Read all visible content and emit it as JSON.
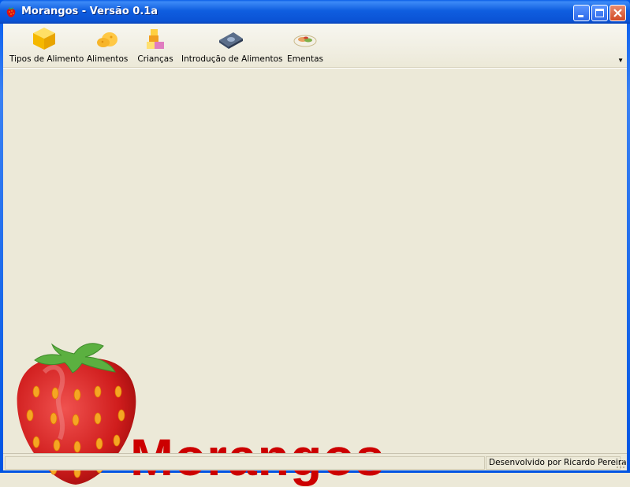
{
  "window": {
    "title": "Morangos - Versão 0.1a",
    "controls": [
      "minimize",
      "maximize",
      "close"
    ]
  },
  "toolbar": {
    "items": [
      {
        "label": "Tipos de Alimento",
        "icon": "yellow-cube-icon"
      },
      {
        "label": "Alimentos",
        "icon": "cheese-icon"
      },
      {
        "label": "Crianças",
        "icon": "toy-blocks-icon"
      },
      {
        "label": "Introdução de Alimentos",
        "icon": "disk-drive-icon"
      },
      {
        "label": "Ementas",
        "icon": "food-plate-icon"
      }
    ]
  },
  "logo": {
    "text": "Morangos",
    "color": "#cc0000"
  },
  "status": {
    "right": "Desenvolvido por Ricardo Pereira"
  }
}
